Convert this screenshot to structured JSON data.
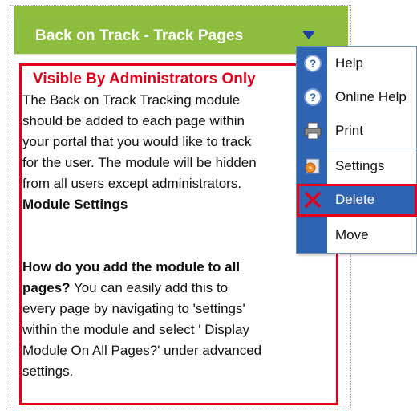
{
  "module": {
    "title": "Back on Track - Track Pages",
    "visibility_label": "Visible By Administrators Only",
    "description_lines": [
      "The Back on Track Tracking module",
      "should be added to each page within",
      "your portal that you would like to track",
      "for the user. The module will be hidden",
      "from all users except administrators."
    ],
    "settings_heading": "Module Settings",
    "faq_question": "How do you add the module to all",
    "faq_question_cont": "pages?",
    "faq_answer_first": " You can easily add this to",
    "faq_answer_lines": [
      "every page by navigating to 'settings'",
      "within the module and select ' Display",
      "Module On All Pages?' under advanced",
      "settings."
    ]
  },
  "menu": {
    "items": [
      {
        "label": "Help",
        "icon": "help-icon"
      },
      {
        "label": "Online Help",
        "icon": "online-help-icon"
      },
      {
        "label": "Print",
        "icon": "printer-icon"
      },
      {
        "label": "Settings",
        "icon": "settings-icon"
      },
      {
        "label": "Delete",
        "icon": "delete-x-icon"
      },
      {
        "label": "Move",
        "icon": ""
      }
    ],
    "active_item": "Delete"
  },
  "colors": {
    "title_bar": "#8dbd3f",
    "highlight_red": "#e2001a",
    "menu_blue": "#2f64b2"
  }
}
